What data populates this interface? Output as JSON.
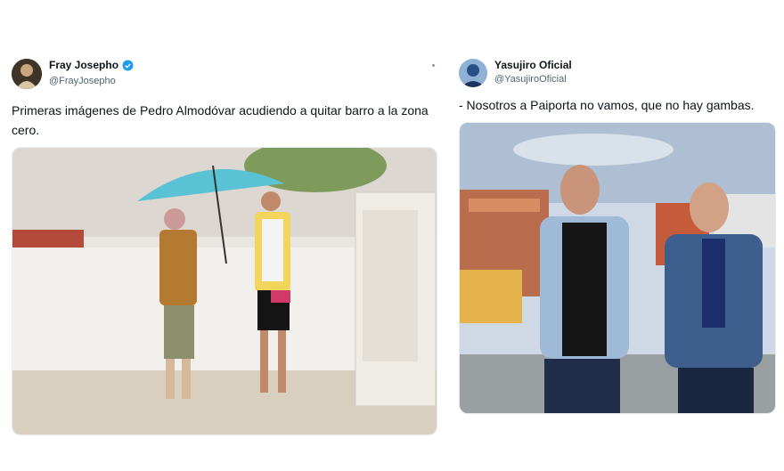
{
  "tweets": [
    {
      "name": "Fray Josepho",
      "handle": "@FrayJosepho",
      "verified": true,
      "text": "Primeras imágenes de Pedro Almodóvar acudiendo a quitar barro a la zona cero.",
      "media_icon": "photo-two-men-umbrella"
    },
    {
      "name": "Yasujiro Oficial",
      "handle": "@YasujiroOficial",
      "verified": false,
      "text": "- Nosotros a Paiporta no vamos, que no hay gambas.",
      "media_icon": "photo-two-men-city"
    }
  ],
  "colors": {
    "verified_blue": "#1d9bf0",
    "handle_gray": "#536471"
  }
}
